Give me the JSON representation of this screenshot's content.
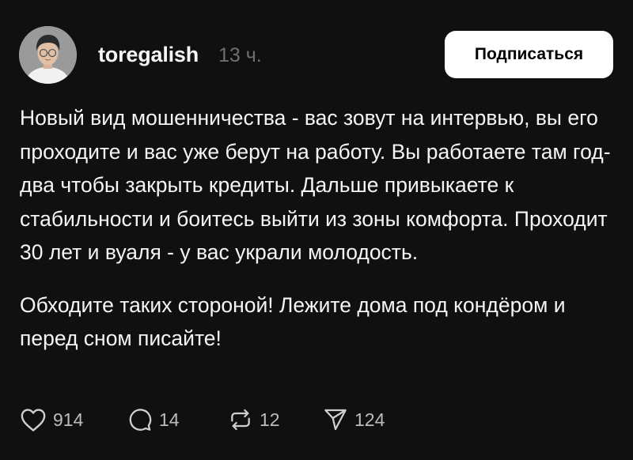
{
  "post": {
    "username": "toregalish",
    "time": "13 ч.",
    "follow_label": "Подписаться",
    "paragraphs": [
      "Новый вид мошенничества - вас зовут на интервью, вы его проходите и вас уже берут на работу. Вы работаете там год-два чтобы закрыть кредиты. Дальше привыкаете к стабильности и боитесь выйти из зоны комфорта. Проходит 30 лет и вуаля - у вас украли молодость.",
      "Обходите таких стороной! Лежите дома под кондёром и перед сном писайте!"
    ],
    "actions": {
      "likes": "914",
      "comments": "14",
      "reposts": "12",
      "shares": "124"
    }
  },
  "icons": {
    "avatar": "profile-photo",
    "like": "heart-icon",
    "comment": "speech-bubble-icon",
    "repost": "repost-arrows-icon",
    "share": "paper-plane-icon"
  },
  "colors": {
    "background": "#101010",
    "text": "#f3f5f7",
    "muted": "#6f6f6f",
    "button_bg": "#ffffff",
    "button_text": "#000000"
  }
}
